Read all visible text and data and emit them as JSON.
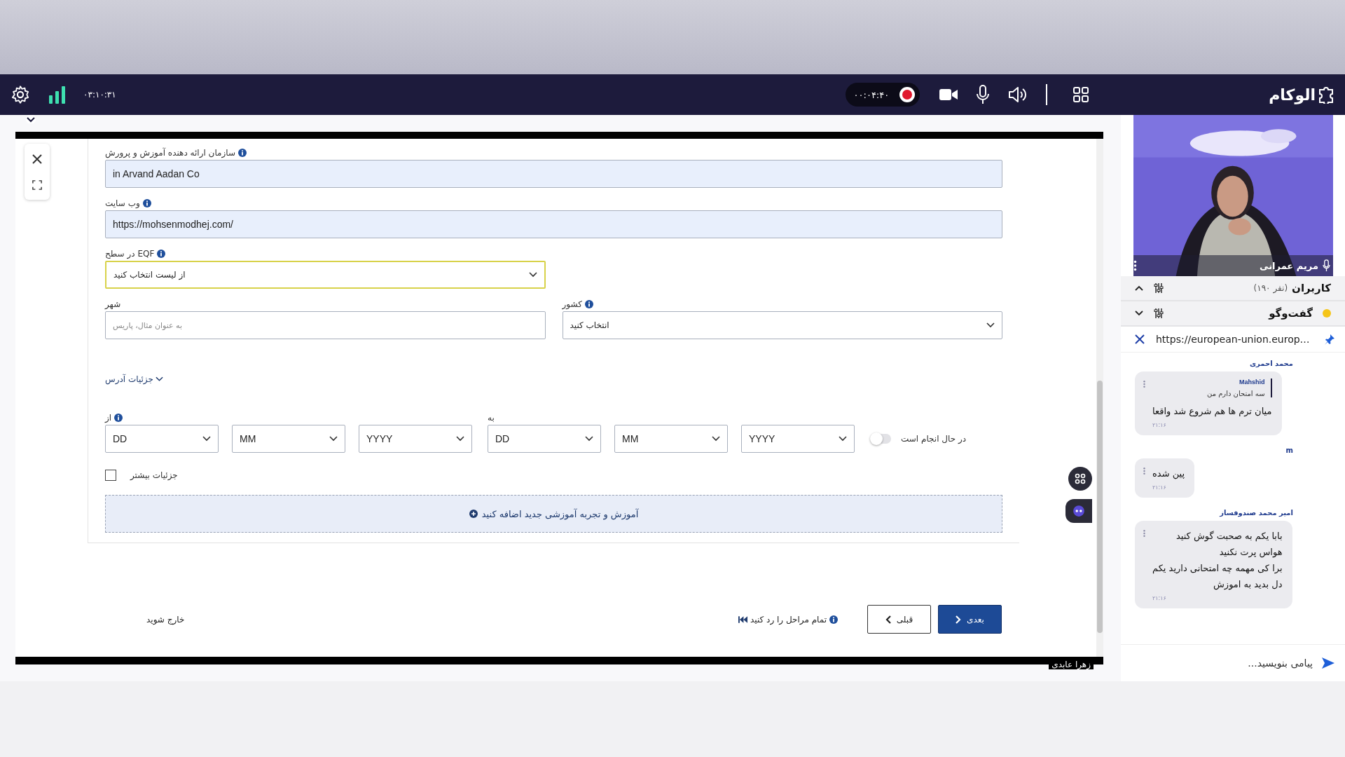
{
  "top_bar": {
    "elapsed": "۰۳:۱۰:۳۱",
    "recording": {
      "time": "۰۰:۰۴:۴۰",
      "on": true
    },
    "logo": "الوکام"
  },
  "form": {
    "fields": [
      {
        "kind": "text",
        "label": "سازمان ارائه دهنده آموزش و پرورش",
        "info": true,
        "value": "in Arvand Aadan Co"
      },
      {
        "kind": "text",
        "label": "وب سایت",
        "info": true,
        "value": "https://mohsenmodhej.com/"
      },
      {
        "kind": "select",
        "label": "در سطح EQF",
        "info": true,
        "value": "از لیست انتخاب کنید",
        "focused": true
      }
    ],
    "city": {
      "label": "شهر",
      "placeholder": "به عنوان مثال، پاریس"
    },
    "country": {
      "label": "کشور",
      "info": true,
      "value": "انتخاب کنید"
    },
    "address_toggle": "جزئیات آدرس",
    "from_date": {
      "label": "از",
      "info": true,
      "day": "DD",
      "month": "MM",
      "year": "YYYY"
    },
    "to_date": {
      "label": "به",
      "info": false,
      "day": "DD",
      "month": "MM",
      "year": "YYYY"
    },
    "ongoing": {
      "label": "در حال انجام است",
      "on": false
    },
    "more_details": {
      "label": "جزئیات بیشتر",
      "checked": false
    },
    "add_button": "آموزش و تجربه آموزشی جدید اضافه کنید",
    "exit": "خارج شوید",
    "skip": "تمام مراحل را رد کنید",
    "previous": "قبلی",
    "next": "بعدی"
  },
  "presenter": "زهرا عابدی",
  "video": {
    "kind": "picture",
    "name": "مریم عمرانی"
  },
  "users": {
    "title": "کاربران",
    "count": "(۱۹۰ نفر)"
  },
  "chat": {
    "title": "گفت‌وگو",
    "pinned": "https://european-union.europ…",
    "messages": [
      {
        "author": "محمد احمری",
        "reply": {
          "author": "Mahshid",
          "text": "سه امتحان دارم من"
        },
        "lines": [
          "میان ترم ها هم شروع شد واقعا"
        ],
        "time": "۲۱:۱۶"
      },
      {
        "author": "m",
        "lines": [
          "پین شده"
        ],
        "time": "۲۱:۱۶"
      },
      {
        "author": "امیر محمد صندوقساز",
        "lines": [
          "بابا یکم به صحبت گوش کنید",
          "هواس پرت نکنید",
          "برا کی مهمه چه امتحانی دارید یکم",
          "دل بدید به اموزش"
        ],
        "time": "۲۱:۱۶"
      }
    ],
    "placeholder": "پیامی بنویسید..."
  }
}
